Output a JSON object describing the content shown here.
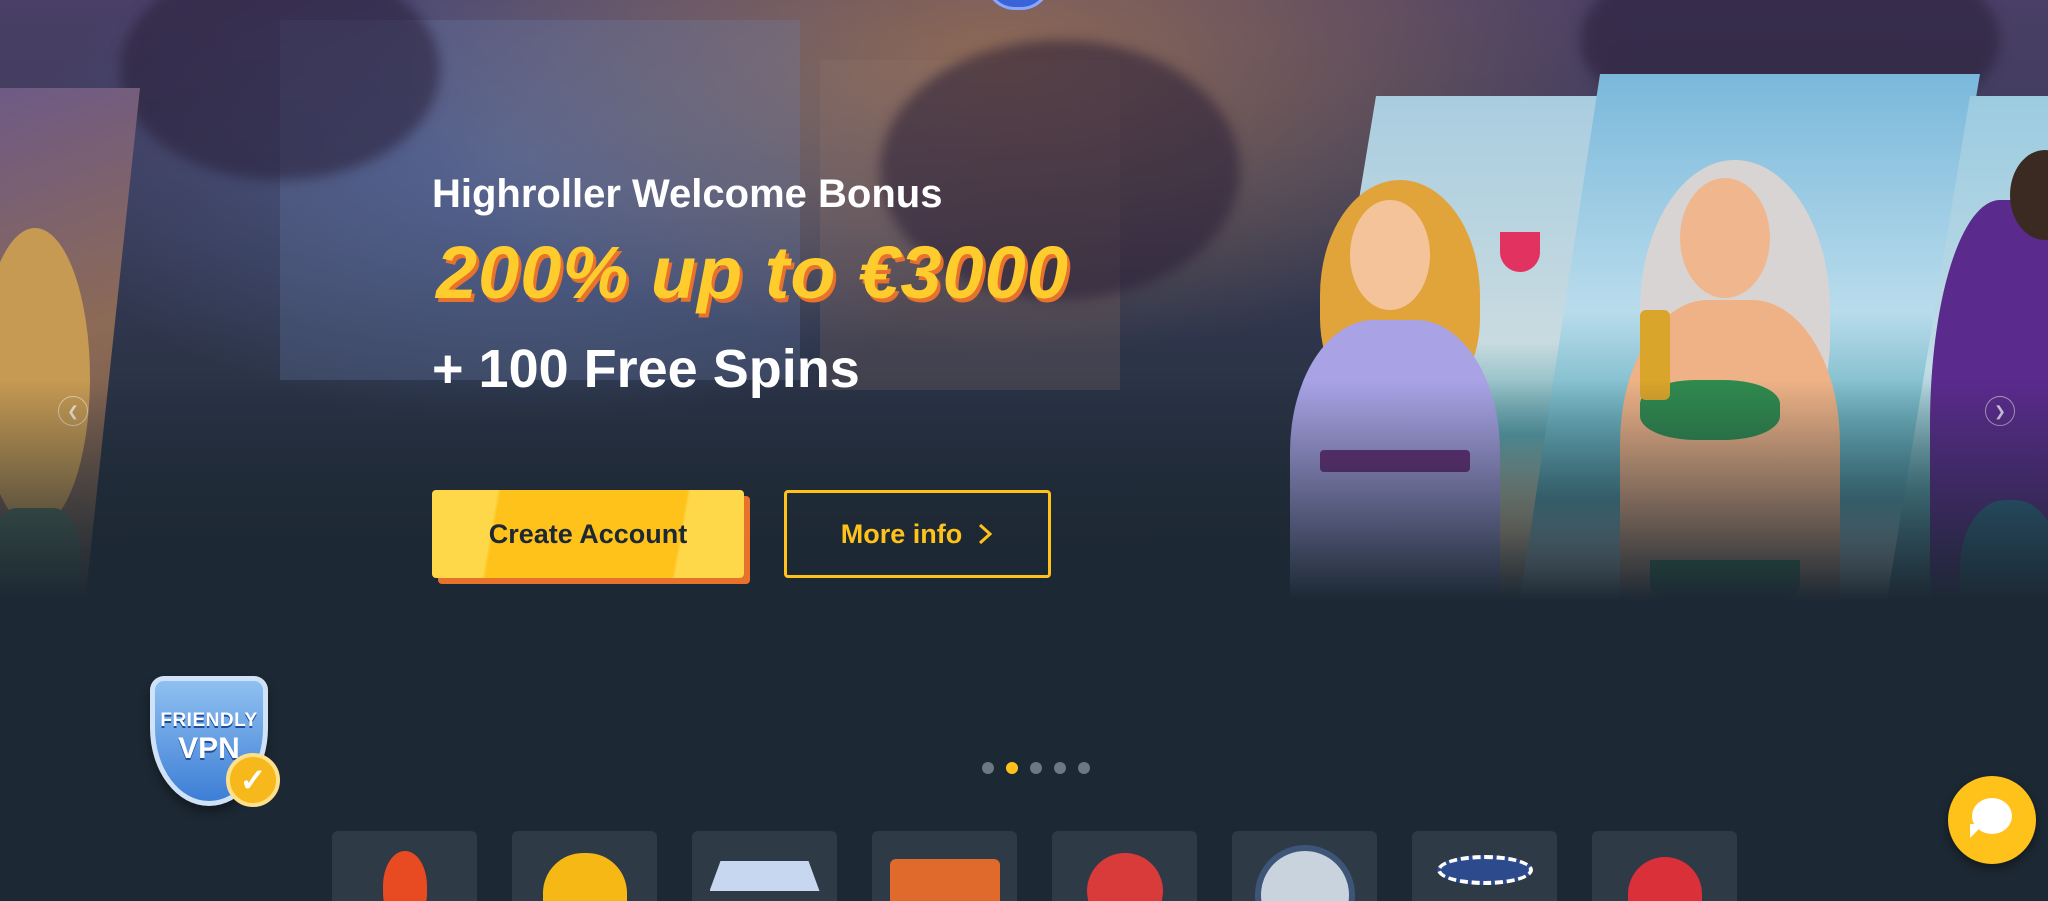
{
  "hero": {
    "subtitle": "Highroller Welcome Bonus",
    "amount": "200% up to €3000",
    "spins": "+ 100 Free Spins",
    "create_account_label": "Create Account",
    "more_info_label": "More info"
  },
  "carousel": {
    "slide_count": 5,
    "active_index": 1,
    "prev_icon": "chevron-left-icon",
    "next_icon": "chevron-right-icon"
  },
  "vpn_badge": {
    "line1": "FRIENDLY",
    "line2": "VPN",
    "check": "✓"
  },
  "categories": [
    {
      "icon": "flame-icon"
    },
    {
      "icon": "clover-icon"
    },
    {
      "icon": "diamond-icon"
    },
    {
      "icon": "slot-machine-icon"
    },
    {
      "icon": "play-icon"
    },
    {
      "icon": "roulette-icon"
    },
    {
      "icon": "poker-chips-icon"
    },
    {
      "icon": "heart-icon"
    }
  ],
  "chat": {
    "icon": "chat-bubble-icon"
  },
  "colors": {
    "background": "#1c2833",
    "accent": "#ffc21a",
    "accent_shadow": "#e8712b",
    "tile": "#2e3a46"
  }
}
